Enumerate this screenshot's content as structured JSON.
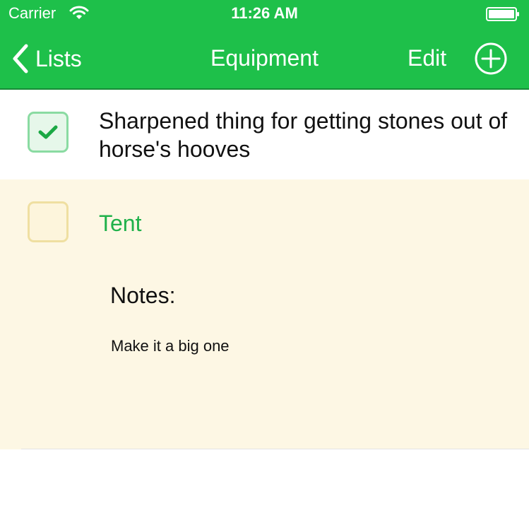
{
  "status_bar": {
    "carrier": "Carrier",
    "time": "11:26 AM",
    "wifi_icon": "wifi-icon",
    "battery_icon": "battery-icon"
  },
  "nav_bar": {
    "back_label": "Lists",
    "title": "Equipment",
    "edit_label": "Edit",
    "add_icon": "plus-circle-icon",
    "back_icon": "chevron-left-icon"
  },
  "items": [
    {
      "label": "Sharpened thing for getting stones out of horse's hooves",
      "checked": true
    },
    {
      "label": "Tent",
      "checked": false,
      "notes_heading": "Notes:",
      "notes": "Make it a big one"
    }
  ],
  "colors": {
    "header_green": "#1ec04a",
    "expanded_row_bg": "#fdf7e4",
    "selected_label_green": "#1fb14a",
    "checkbox_checked_border": "#8adba2",
    "checkbox_unchecked_border": "#efdfa1"
  }
}
